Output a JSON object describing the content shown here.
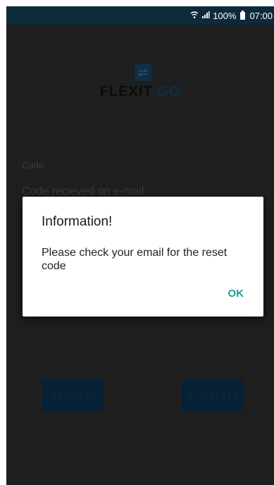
{
  "statusbar": {
    "battery_text": "100%",
    "time": "07:00"
  },
  "logo": {
    "brand": "FLEXIT",
    "brand_suffix": "GO"
  },
  "form": {
    "code_label": "Code",
    "code_placeholder": "Code recieved on e-mail",
    "code_value": ""
  },
  "buttons": {
    "back_label": "Back",
    "login_label": "Login"
  },
  "dialog": {
    "title": "Information!",
    "message": "Please check your email for the reset code",
    "ok_label": "OK"
  },
  "colors": {
    "accent": "#1aa19a",
    "statusbar": "#0d2a3d",
    "brand_dark": "#0d2f47"
  }
}
